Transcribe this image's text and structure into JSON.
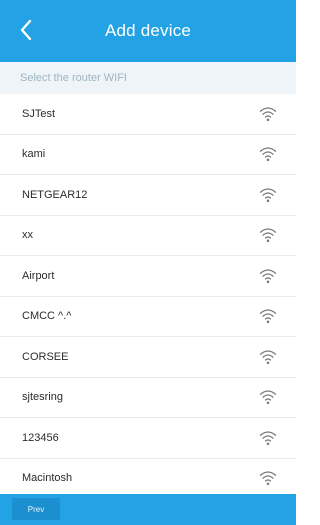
{
  "header": {
    "title": "Add device",
    "back_icon": "chevron-left-icon"
  },
  "subheader": {
    "text": "Select the router WIFI"
  },
  "networks": [
    {
      "ssid": "SJTest",
      "icon": "wifi-icon"
    },
    {
      "ssid": "kami",
      "icon": "wifi-icon"
    },
    {
      "ssid": "NETGEAR12",
      "icon": "wifi-icon"
    },
    {
      "ssid": "xx",
      "icon": "wifi-icon"
    },
    {
      "ssid": "Airport",
      "icon": "wifi-icon"
    },
    {
      "ssid": "CMCC ^.^",
      "icon": "wifi-icon"
    },
    {
      "ssid": "CORSEE",
      "icon": "wifi-icon"
    },
    {
      "ssid": "sjtesring",
      "icon": "wifi-icon"
    },
    {
      "ssid": "123456",
      "icon": "wifi-icon"
    },
    {
      "ssid": "Macintosh",
      "icon": "wifi-icon"
    }
  ],
  "footer": {
    "prev_label": "Prev"
  },
  "colors": {
    "accent": "#23a3e6",
    "subheader_bg": "#eef4f8",
    "subheader_text": "#9fb5c2",
    "icon": "#7a7a7a"
  }
}
